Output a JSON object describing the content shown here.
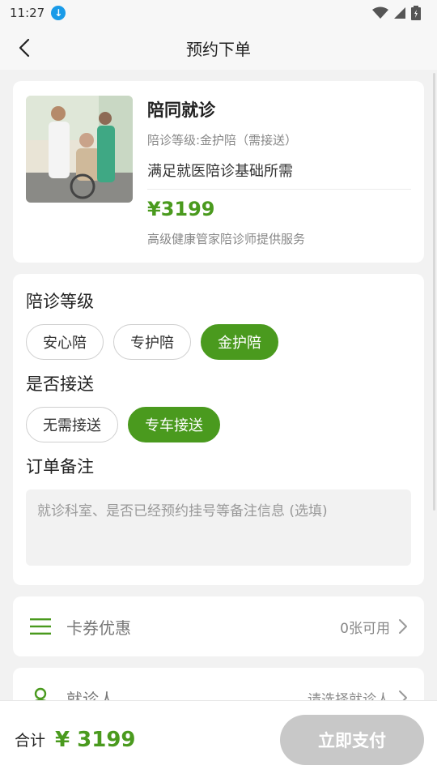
{
  "status": {
    "time": "11:27"
  },
  "header": {
    "title": "预约下单"
  },
  "product": {
    "name": "陪同就诊",
    "level": "陪诊等级:金护陪（需接送）",
    "desc": "满足就医陪诊基础所需",
    "price": "¥3199",
    "provider": "高级健康管家陪诊师提供服务"
  },
  "options": {
    "level_title": "陪诊等级",
    "levels": [
      {
        "label": "安心陪",
        "active": false
      },
      {
        "label": "专护陪",
        "active": false
      },
      {
        "label": "金护陪",
        "active": true
      }
    ],
    "transfer_title": "是否接送",
    "transfers": [
      {
        "label": "无需接送",
        "active": false
      },
      {
        "label": "专车接送",
        "active": true
      }
    ],
    "remark_title": "订单备注",
    "remark_placeholder": "就诊科室、是否已经预约挂号等备注信息 (选填)"
  },
  "coupon": {
    "label": "卡券优惠",
    "value": "0张可用",
    "icon": "menu-icon"
  },
  "patient": {
    "label": "就诊人",
    "value": "请选择就诊人",
    "icon": "person-icon"
  },
  "footer": {
    "total_label": "合计",
    "total_price": "¥ 3199",
    "pay_label": "立即支付"
  },
  "colors": {
    "accent": "#4a9a1e",
    "pay_disabled": "#c8c8c8",
    "background": "#f2f2f2"
  }
}
